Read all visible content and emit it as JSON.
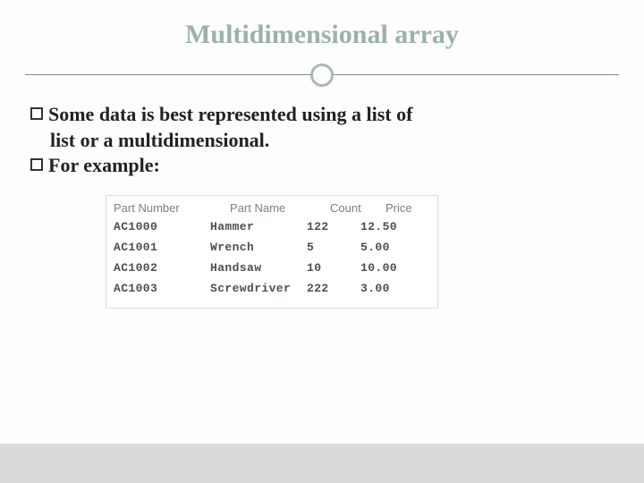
{
  "title": "Multidimensional array",
  "bullets": [
    {
      "line1": "Some data is best represented using a list of",
      "line2": "list or a multidimensional."
    },
    {
      "line1": "For example:",
      "line2": ""
    }
  ],
  "table": {
    "headers": {
      "part_number": "Part Number",
      "part_name": "Part Name",
      "count": "Count",
      "price": "Price"
    },
    "rows": [
      {
        "pn": "AC1000",
        "name": "Hammer",
        "count": "122",
        "price": "12.50"
      },
      {
        "pn": "AC1001",
        "name": "Wrench",
        "count": "5",
        "price": "5.00"
      },
      {
        "pn": "AC1002",
        "name": "Handsaw",
        "count": "10",
        "price": "10.00"
      },
      {
        "pn": "AC1003",
        "name": "Screwdriver",
        "count": "222",
        "price": "3.00"
      }
    ]
  },
  "chart_data": {
    "type": "table",
    "columns": [
      "Part Number",
      "Part Name",
      "Count",
      "Price"
    ],
    "rows": [
      [
        "AC1000",
        "Hammer",
        122,
        12.5
      ],
      [
        "AC1001",
        "Wrench",
        5,
        5.0
      ],
      [
        "AC1002",
        "Handsaw",
        10,
        10.0
      ],
      [
        "AC1003",
        "Screwdriver",
        222,
        3.0
      ]
    ]
  }
}
